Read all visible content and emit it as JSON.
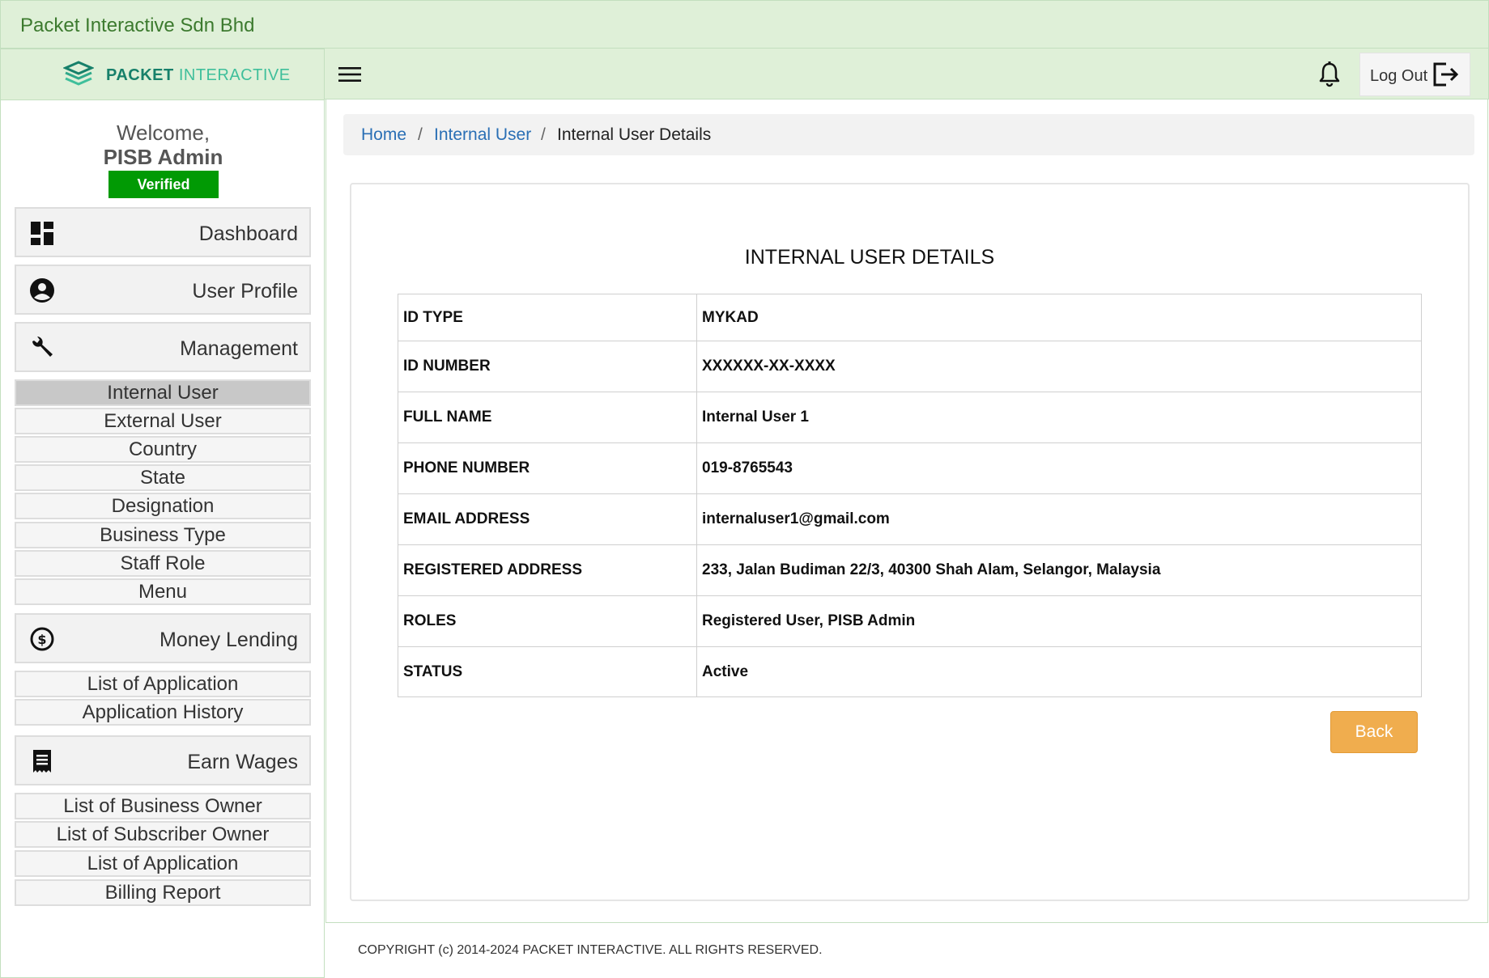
{
  "app": {
    "title": "Packet Interactive Sdn Bhd"
  },
  "brand": {
    "part1": "PACKET",
    "part2": "INTERACTIVE"
  },
  "user": {
    "welcome": "Welcome,",
    "name": "PISB Admin",
    "badge": "Verified",
    "badge_color": "#019a04"
  },
  "sidebar": {
    "dashboard": {
      "label": "Dashboard",
      "icon": "dashboard-icon"
    },
    "user_profile": {
      "label": "User Profile",
      "icon": "account-circle-icon"
    },
    "management": {
      "label": "Management",
      "icon": "wrench-icon",
      "items": [
        "Internal User",
        "External User",
        "Country",
        "State",
        "Designation",
        "Business Type",
        "Staff Role",
        "Menu"
      ],
      "active": "Internal User"
    },
    "money_lending": {
      "label": "Money Lending",
      "icon": "dollar-circle-icon",
      "items": [
        "List of Application",
        "Application History"
      ]
    },
    "earn_wages": {
      "label": "Earn Wages",
      "icon": "receipt-icon",
      "items": [
        "List of Business Owner",
        "List of Subscriber Owner",
        "List of Application",
        "Billing Report"
      ]
    }
  },
  "topnav": {
    "logout_label": "Log Out",
    "menu_icon": "hamburger-icon",
    "bell_icon": "bell-icon",
    "logout_icon": "logout-icon"
  },
  "breadcrumb": {
    "home": "Home",
    "section": "Internal User",
    "current": "Internal User Details",
    "separator": "/"
  },
  "details": {
    "title": "INTERNAL USER DETAILS",
    "rows": [
      {
        "label": "ID TYPE",
        "value": "MYKAD"
      },
      {
        "label": "ID NUMBER",
        "value": "XXXXXX-XX-XXXX"
      },
      {
        "label": "FULL NAME",
        "value": "Internal User 1"
      },
      {
        "label": "PHONE NUMBER",
        "value": "019-8765543"
      },
      {
        "label": "EMAIL ADDRESS",
        "value": "internaluser1@gmail.com"
      },
      {
        "label": "REGISTERED ADDRESS",
        "value": "233, Jalan Budiman 22/3, 40300 Shah Alam, Selangor, Malaysia"
      },
      {
        "label": "ROLES",
        "value": "Registered User, PISB Admin"
      },
      {
        "label": "STATUS",
        "value": "Active"
      }
    ],
    "back_label": "Back",
    "back_color": "#f0ad4e"
  },
  "footer": {
    "text": "COPYRIGHT (c) 2014-2024 PACKET INTERACTIVE. ALL RIGHTS RESERVED."
  }
}
